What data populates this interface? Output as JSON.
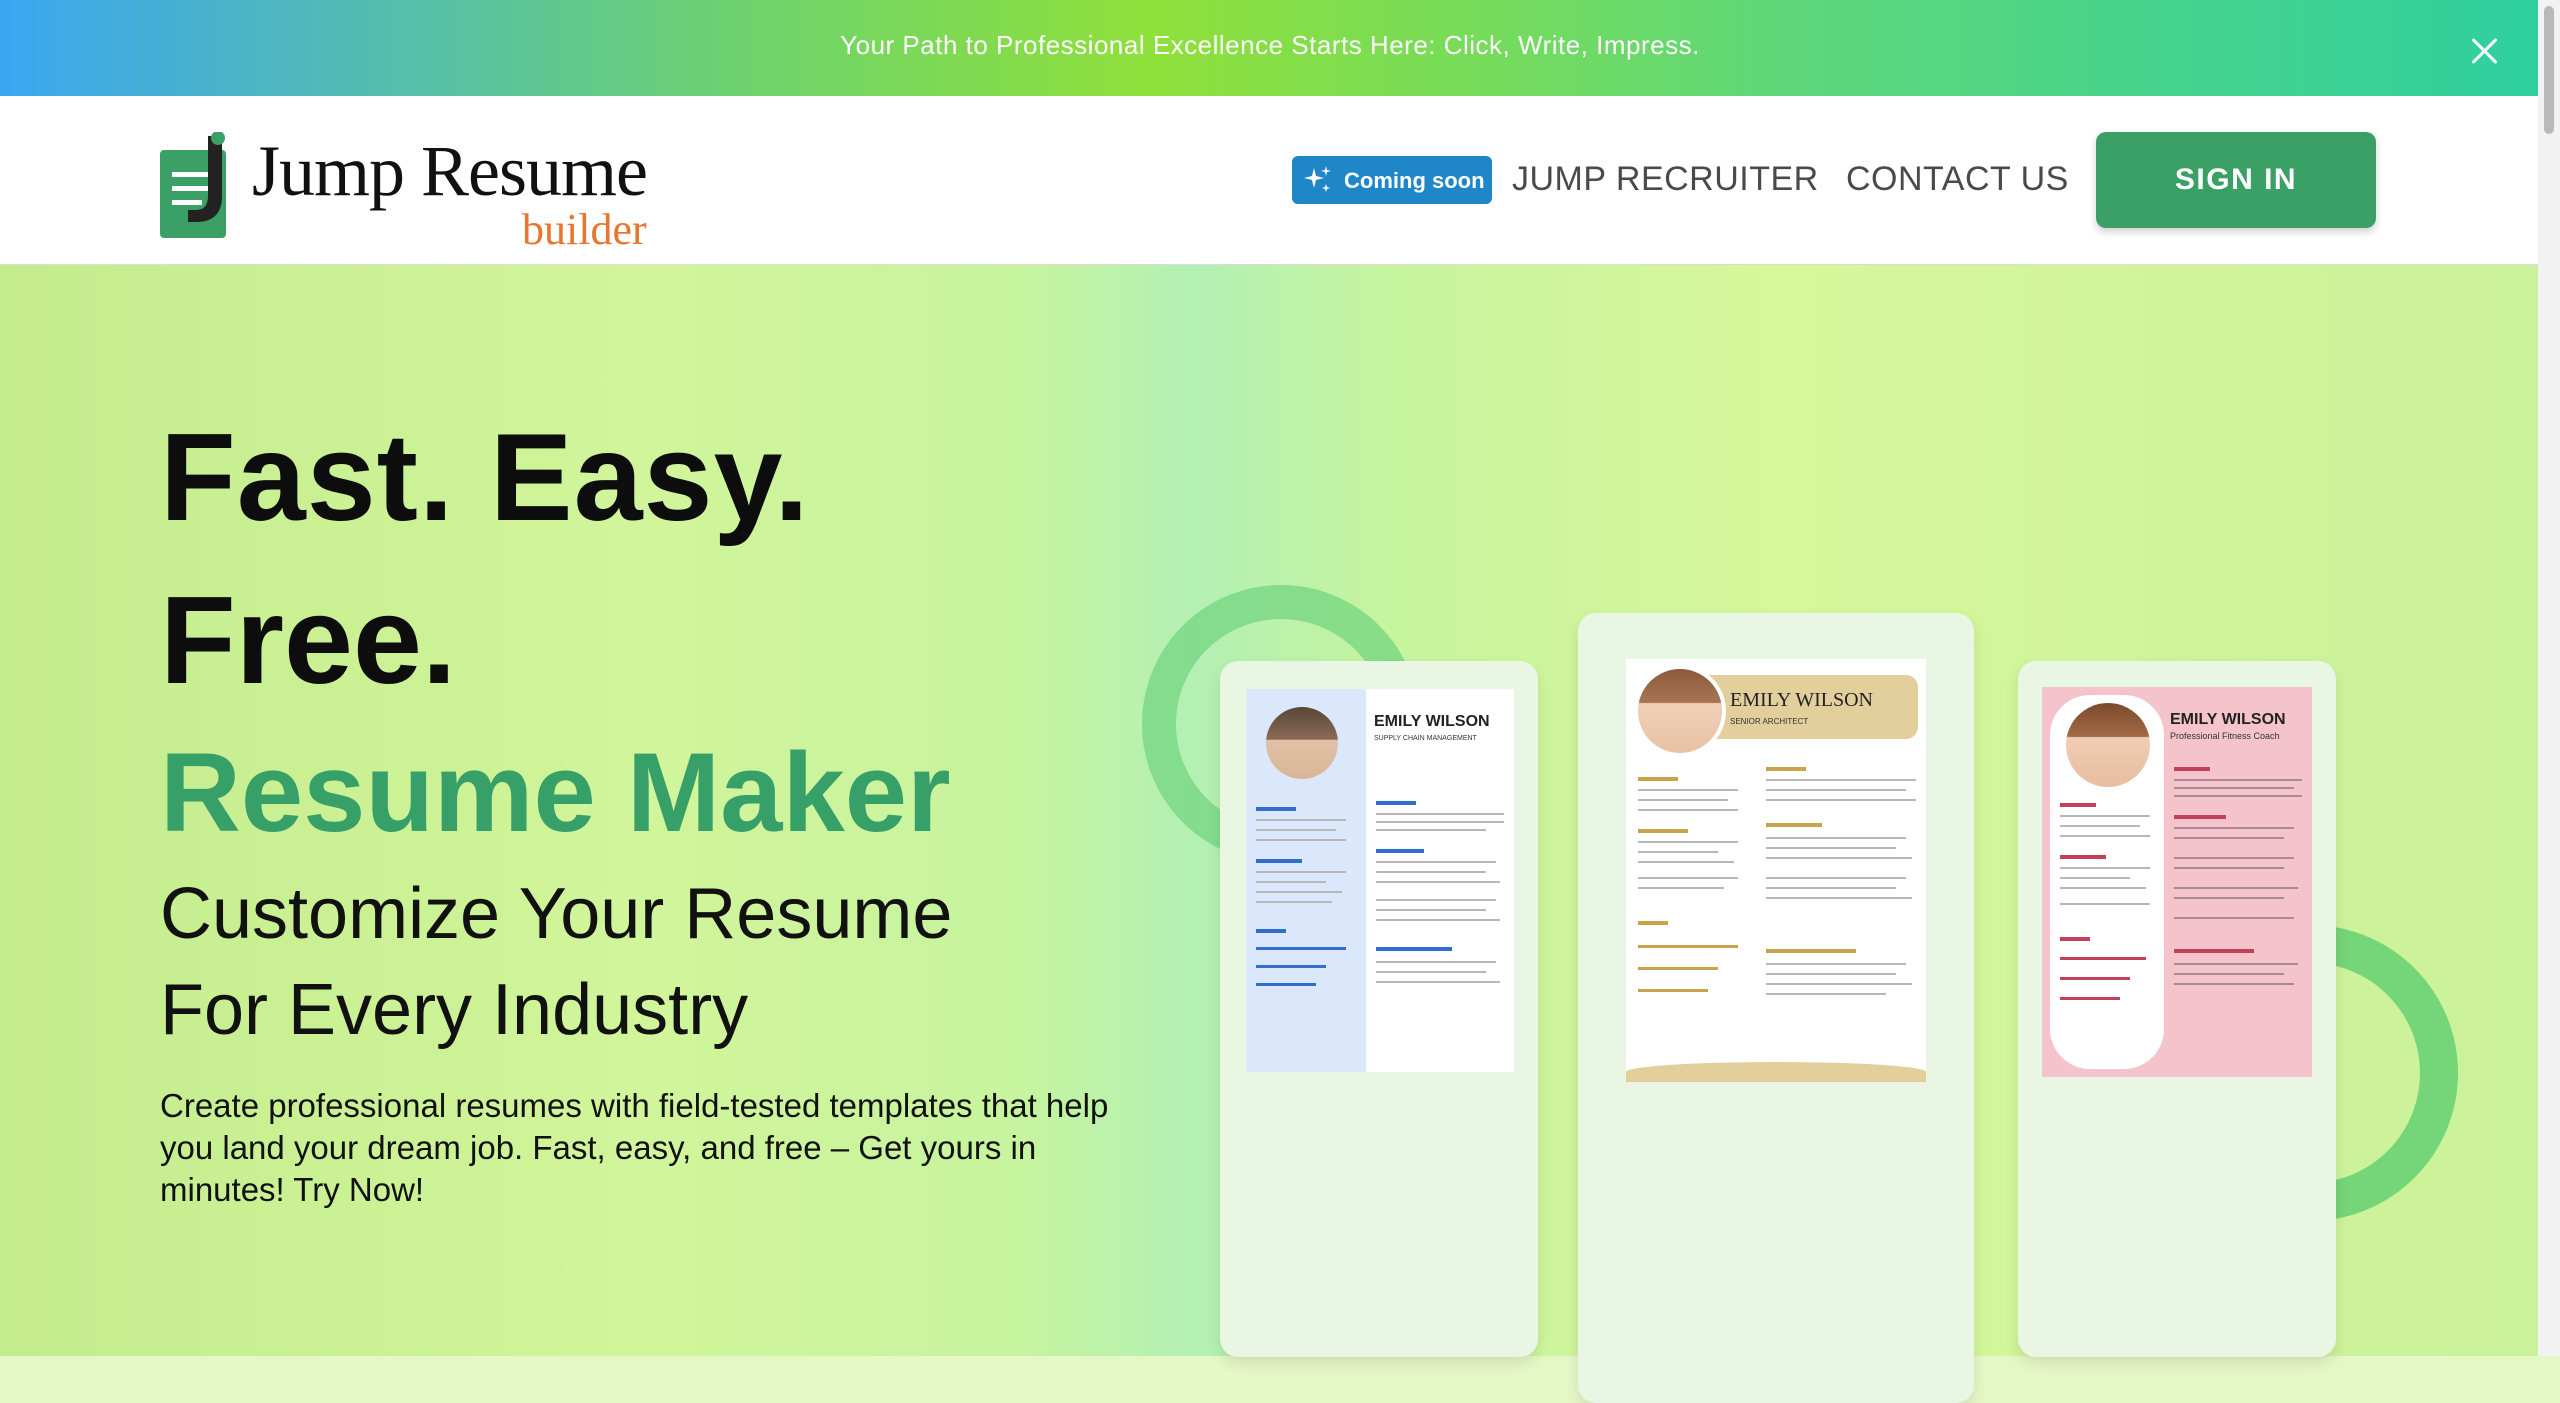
{
  "announcement": {
    "text": "Your Path to Professional Excellence Starts Here: Click, Write, Impress."
  },
  "brand": {
    "name": "Jump Resume",
    "tagline": "builder"
  },
  "nav": {
    "badge": "Coming soon",
    "links": [
      "JUMP RECRUITER",
      "CONTACT US"
    ],
    "signin": "SIGN IN"
  },
  "hero": {
    "line1": "Fast. Easy.",
    "line2": "Free.",
    "line3": "Resume Maker",
    "sub1": "Customize Your Resume",
    "sub2": "For Every Industry",
    "description": "Create professional resumes with field-tested templates that help you land your dream job. Fast, easy, and free – Get yours in minutes! Try Now!"
  },
  "resumes": [
    {
      "name": "EMILY WILSON",
      "title": "SUPPLY CHAIN MANAGEMENT",
      "accent": "#2f6fd0"
    },
    {
      "name": "EMILY WILSON",
      "title": "SENIOR ARCHITECT",
      "accent": "#c9a24a"
    },
    {
      "name": "EMILY WILSON",
      "title": "Professional Fitness Coach",
      "accent": "#c2415a"
    }
  ],
  "colors": {
    "brand_green": "#3ba065",
    "hero_green": "#36a068",
    "orange": "#e8762e",
    "badge_blue": "#1f86c8"
  }
}
